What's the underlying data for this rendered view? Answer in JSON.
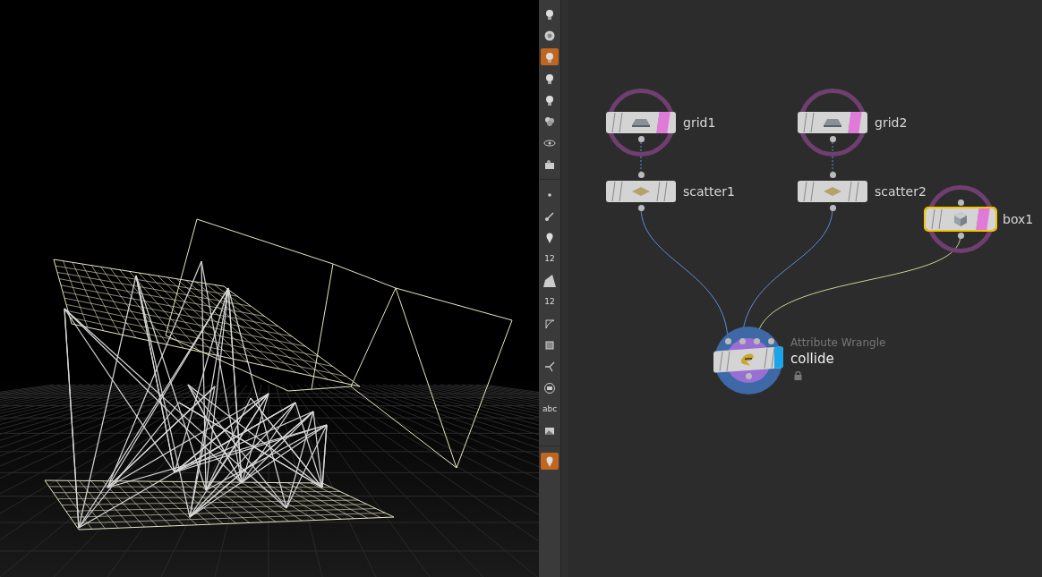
{
  "toolbar": {
    "tools": [
      {
        "selected": false
      },
      {
        "selected": false
      },
      {
        "selected": true
      },
      {
        "selected": false
      },
      {
        "selected": false
      },
      {
        "selected": false
      },
      {
        "selected": false
      },
      {
        "selected": false
      },
      {
        "selected": false
      },
      {
        "selected": false
      },
      {
        "selected": false
      },
      {
        "selected": false,
        "label": "12"
      },
      {
        "selected": false
      },
      {
        "selected": false,
        "label": "12"
      },
      {
        "selected": false
      },
      {
        "selected": false
      },
      {
        "selected": false
      },
      {
        "selected": false
      },
      {
        "selected": false,
        "label": "abc"
      },
      {
        "selected": false
      },
      {
        "selected": true
      }
    ]
  },
  "network": {
    "nodes": [
      {
        "name": "grid1",
        "kind": "grid",
        "ring": true,
        "template": true,
        "display": false,
        "selected": false
      },
      {
        "name": "grid2",
        "kind": "grid",
        "ring": true,
        "template": true,
        "display": false,
        "selected": false
      },
      {
        "name": "scatter1",
        "kind": "scatter",
        "ring": false,
        "template": false,
        "display": false,
        "selected": false
      },
      {
        "name": "scatter2",
        "kind": "scatter",
        "ring": false,
        "template": false,
        "display": false,
        "selected": false
      },
      {
        "name": "box1",
        "kind": "box",
        "ring": true,
        "template": true,
        "display": false,
        "selected": true
      },
      {
        "name": "collide",
        "kind": "wrangle",
        "ring": false,
        "template": false,
        "display": true,
        "selected": false,
        "type_label": "Attribute Wrangle",
        "locked": true
      }
    ]
  }
}
